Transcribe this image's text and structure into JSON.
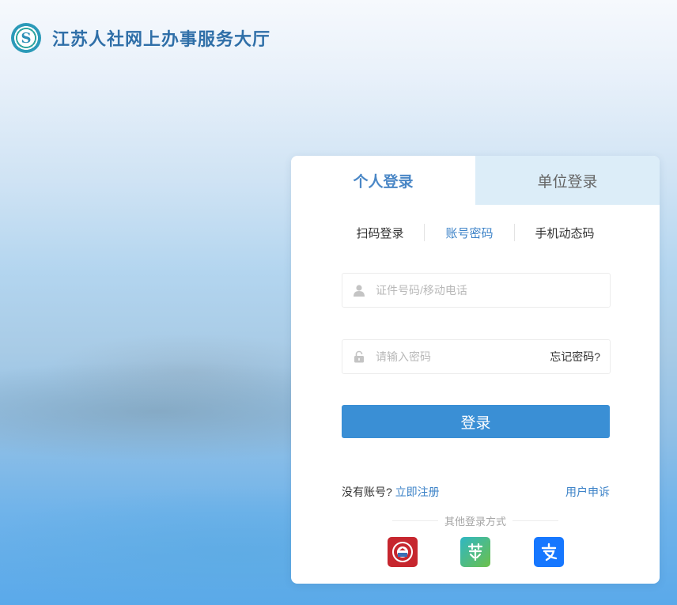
{
  "header": {
    "logo_letter": "S",
    "title": "江苏人社网上办事服务大厅"
  },
  "tabs": {
    "personal": "个人登录",
    "unit": "单位登录"
  },
  "methods": {
    "scan": "扫码登录",
    "password": "账号密码",
    "sms": "手机动态码"
  },
  "form": {
    "username_placeholder": "证件号码/移动电话",
    "password_placeholder": "请输入密码",
    "forgot": "忘记密码?",
    "login_button": "登录"
  },
  "footer": {
    "no_account": "没有账号?",
    "register": "立即注册",
    "complaint": "用户申诉",
    "other_methods": "其他登录方式"
  },
  "colors": {
    "accent": "#3a8fd5",
    "tab_inactive_bg": "#dcedf8"
  },
  "icons": [
    "user-icon",
    "lock-icon",
    "social-security-app-icon",
    "su-app-icon",
    "alipay-icon"
  ]
}
